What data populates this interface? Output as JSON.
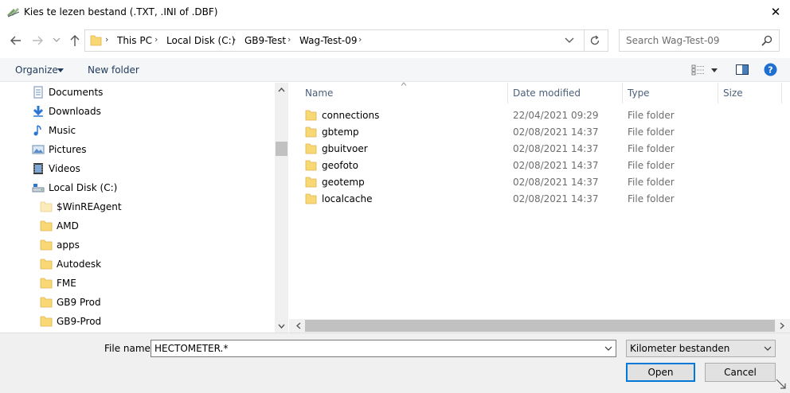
{
  "window": {
    "title": "Kies te lezen bestand (.TXT, .INI of .DBF)",
    "close_glyph": "✕"
  },
  "address": {
    "crumbs": [
      "This PC",
      "Local Disk (C:)",
      "GB9-Test",
      "Wag-Test-09"
    ],
    "separator": "›",
    "search_placeholder": "Search Wag-Test-09"
  },
  "toolbar": {
    "organize_label": "Organize",
    "new_folder_label": "New folder"
  },
  "nav": {
    "items": [
      {
        "label": "Documents",
        "icon": "documents-icon"
      },
      {
        "label": "Downloads",
        "icon": "downloads-icon"
      },
      {
        "label": "Music",
        "icon": "music-icon"
      },
      {
        "label": "Pictures",
        "icon": "pictures-icon"
      },
      {
        "label": "Videos",
        "icon": "videos-icon"
      },
      {
        "label": "Local Disk (C:)",
        "icon": "drive-icon"
      },
      {
        "label": "$WinREAgent",
        "icon": "folder-icon"
      },
      {
        "label": "AMD",
        "icon": "folder-icon"
      },
      {
        "label": "apps",
        "icon": "folder-icon"
      },
      {
        "label": "Autodesk",
        "icon": "folder-icon"
      },
      {
        "label": "FME",
        "icon": "folder-icon"
      },
      {
        "label": "GB9 Prod",
        "icon": "folder-icon"
      },
      {
        "label": "GB9-Prod",
        "icon": "folder-icon"
      }
    ]
  },
  "files": {
    "columns": [
      "Name",
      "Date modified",
      "Type",
      "Size"
    ],
    "rows": [
      {
        "name": "connections",
        "date": "22/04/2021 09:29",
        "type": "File folder"
      },
      {
        "name": "gbtemp",
        "date": "02/08/2021 14:37",
        "type": "File folder"
      },
      {
        "name": "gbuitvoer",
        "date": "02/08/2021 14:37",
        "type": "File folder"
      },
      {
        "name": "geofoto",
        "date": "02/08/2021 14:37",
        "type": "File folder"
      },
      {
        "name": "geotemp",
        "date": "02/08/2021 14:37",
        "type": "File folder"
      },
      {
        "name": "localcache",
        "date": "02/08/2021 14:37",
        "type": "File folder"
      }
    ]
  },
  "footer": {
    "file_name_label": "File name:",
    "file_name_value": "HECTOMETER.*",
    "filter_value": "Kilometer bestanden",
    "open_label": "Open",
    "cancel_label": "Cancel"
  },
  "colors": {
    "accent": "#0078d7",
    "folder": "#f8d775",
    "header_text": "#4c607a"
  }
}
